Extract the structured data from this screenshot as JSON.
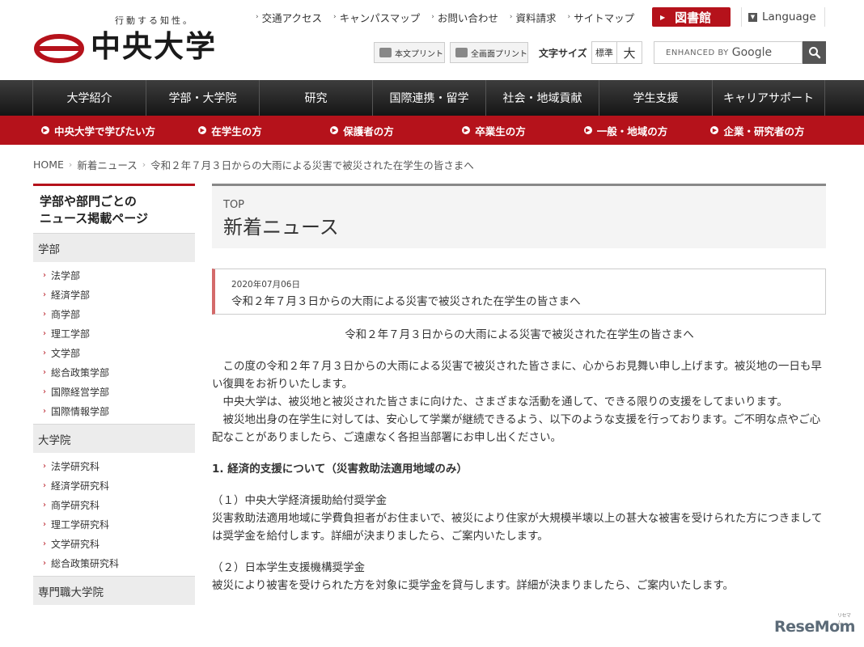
{
  "header": {
    "tagline": "行動する知性。",
    "logo_text": "中央大学",
    "top_links": [
      "交通アクセス",
      "キャンパスマップ",
      "お問い合わせ",
      "資料請求",
      "サイトマップ"
    ],
    "library_button": "図書館",
    "language_button": "Language",
    "print_body": "本文プリント",
    "print_full": "全画面プリント",
    "font_size_label": "文字サイズ",
    "font_size_normal": "標準",
    "font_size_large": "大",
    "search_placeholder": "ENHANCED BY",
    "search_brand": "Google"
  },
  "main_nav": [
    "大学紹介",
    "学部・大学院",
    "研究",
    "国際連携・留学",
    "社会・地域貢献",
    "学生支援",
    "キャリアサポート"
  ],
  "sub_nav": [
    "中央大学で学びたい方",
    "在学生の方",
    "保護者の方",
    "卒業生の方",
    "一般・地域の方",
    "企業・研究者の方"
  ],
  "breadcrumb": [
    "HOME",
    "新着ニュース",
    "令和２年７月３日からの大雨による災害で被災された在学生の皆さまへ"
  ],
  "sidebar": {
    "heading_line1": "学部や部門ごとの",
    "heading_line2": "ニュース掲載ページ",
    "categories": [
      {
        "label": "学部",
        "items": [
          "法学部",
          "経済学部",
          "商学部",
          "理工学部",
          "文学部",
          "総合政策学部",
          "国際経営学部",
          "国際情報学部"
        ]
      },
      {
        "label": "大学院",
        "items": [
          "法学研究科",
          "経済学研究科",
          "商学研究科",
          "理工学研究科",
          "文学研究科",
          "総合政策研究科"
        ]
      },
      {
        "label": "専門職大学院",
        "items": []
      }
    ]
  },
  "page_head": {
    "sup": "TOP",
    "title": "新着ニュース"
  },
  "news": {
    "date": "2020年07月06日",
    "title": "令和２年７月３日からの大雨による災害で被災された在学生の皆さまへ"
  },
  "article": {
    "heading": "令和２年７月３日からの大雨による災害で被災された在学生の皆さまへ",
    "p1": "この度の令和２年７月３日からの大雨による災害で被災された皆さまに、心からお見舞い申し上げます。被災地の一日も早い復興をお祈りいたします。",
    "p2": "中央大学は、被災地と被災された皆さまに向けた、さまざまな活動を通して、できる限りの支援をしてまいります。",
    "p3": "被災地出身の在学生に対しては、安心して学業が継続できるよう、以下のような支援を行っております。ご不明な点やご心配なことがありましたら、ご遠慮なく各担当部署にお申し出ください。",
    "section1": "1.  経済的支援について（災害救助法適用地域のみ）",
    "s1_title": "（１）中央大学経済援助給付奨学金",
    "s1_body": "災害救助法適用地域に学費負担者がお住まいで、被災により住家が大規模半壊以上の甚大な被害を受けられた方につきましては奨学金を給付します。詳細が決まりましたら、ご案内いたします。",
    "s2_title": "（２）日本学生支援機構奨学金",
    "s2_body": "被災により被害を受けられた方を対象に奨学金を貸与します。詳細が決まりましたら、ご案内いたします。"
  },
  "watermark": {
    "main": "ReseMom",
    "small": "リセマム"
  },
  "colors": {
    "brand_red": "#b5121b",
    "nav_dark": "#1f1f1f"
  }
}
